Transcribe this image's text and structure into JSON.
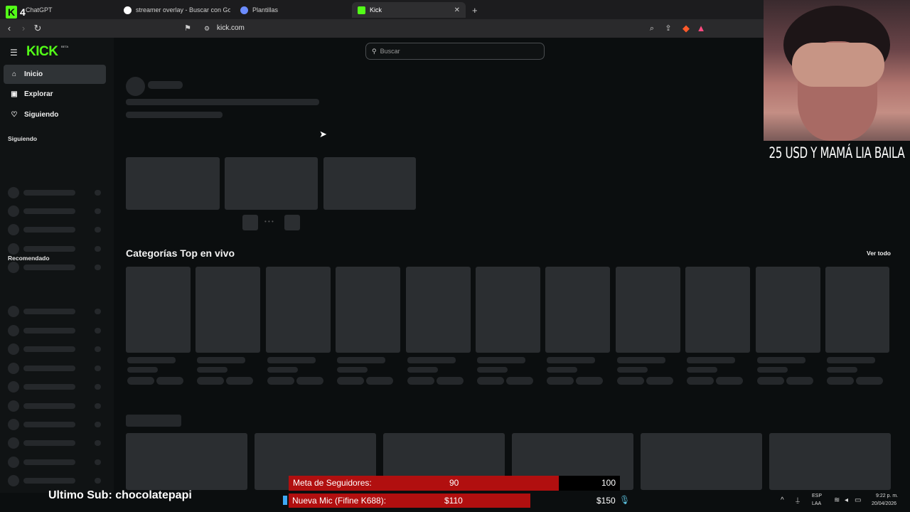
{
  "browser": {
    "tabs": [
      {
        "label": "ChatGPT",
        "active": false
      },
      {
        "label": "streamer overlay - Buscar con Google",
        "active": false
      },
      {
        "label": "Plantillas",
        "active": false
      },
      {
        "label": "Kick",
        "active": true
      }
    ],
    "url": "kick.com"
  },
  "kick": {
    "logo": "KICK",
    "logo_badge": "BETA",
    "search_placeholder": "Buscar",
    "nav": [
      {
        "label": "Inicio",
        "icon": "home-icon",
        "active": true
      },
      {
        "label": "Explorar",
        "icon": "explore-icon",
        "active": false
      },
      {
        "label": "Siguiendo",
        "icon": "heart-icon",
        "active": false
      }
    ],
    "following_heading": "Siguiendo",
    "recommended_heading": "Recomendado",
    "top_categories_title": "Categorías Top en vivo",
    "see_all": "Ver todo"
  },
  "overlay": {
    "corner_badge": "4",
    "banner_text": "25 USD Y MAMÁ LIA BAILA",
    "last_sub": "Ultimo Sub: chocolatepapi",
    "follower_goal": {
      "label": "Meta de Seguidores:",
      "current": "90",
      "target": "100",
      "progress": 0.9
    },
    "mic_goal": {
      "label": "Nueva Mic (Fifine K688):",
      "current": "$110",
      "target": "$150",
      "progress": 0.733
    }
  },
  "system_tray": {
    "lang": "ESP",
    "layout": "LAA",
    "time": "9:22 p. m.",
    "date": "20/04/2026"
  },
  "colors": {
    "kick_green": "#53fc18",
    "goal_red": "#b10f0f"
  }
}
